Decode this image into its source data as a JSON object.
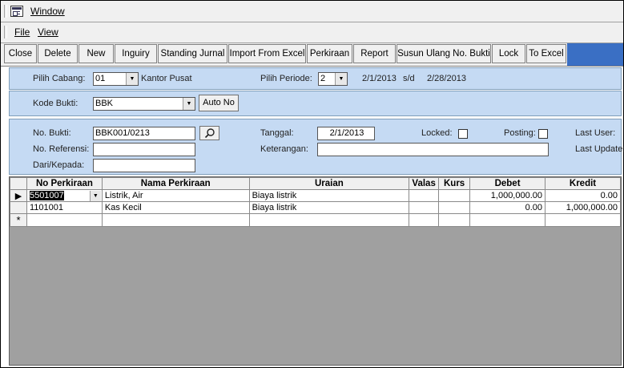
{
  "window_menu": {
    "label": "Window",
    "icon": "window-icon"
  },
  "menus": {
    "file": "File",
    "view": "View"
  },
  "toolbar": {
    "close": "Close",
    "delete": "Delete",
    "new": "New",
    "inquiry": "Inguiry",
    "standing_jurnal": "Standing Jurnal",
    "import_excel": "Import From Excel",
    "perkiraan": "Perkiraan",
    "report": "Report",
    "susun_ulang": "Susun Ulang No. Bukti",
    "lock": "Lock",
    "to_excel": "To Excel"
  },
  "filter": {
    "cabang_label": "Pilih Cabang:",
    "cabang_value": "01",
    "cabang_name": "Kantor Pusat",
    "periode_label": "Pilih Periode:",
    "periode_value": "2",
    "periode_from": "2/1/2013",
    "periode_sep": "s/d",
    "periode_to": "2/28/2013"
  },
  "kode": {
    "label": "Kode Bukti:",
    "value": "BBK",
    "auto_no": "Auto No"
  },
  "form": {
    "no_bukti_label": "No. Bukti:",
    "no_bukti_value": "BBK001/0213",
    "no_referensi_label": "No. Referensi:",
    "no_referensi_value": "",
    "dari_kepada_label": "Dari/Kepada:",
    "dari_kepada_value": "",
    "tanggal_label": "Tanggal:",
    "tanggal_value": "2/1/2013",
    "keterangan_label": "Keterangan:",
    "keterangan_value": "",
    "locked_label": "Locked:",
    "posting_label": "Posting:",
    "last_user_label": "Last User:",
    "last_update_label": "Last Update:"
  },
  "grid": {
    "columns": [
      "No Perkiraan",
      "Nama Perkiraan",
      "Uraian",
      "Valas",
      "Kurs",
      "Debet",
      "Kredit"
    ],
    "rows": [
      {
        "no": "5501007",
        "nama": "Listrik, Air",
        "uraian": "Biaya listrik",
        "valas": "",
        "kurs": "",
        "debet": "1,000,000.00",
        "kredit": "0.00"
      },
      {
        "no": "1101001",
        "nama": "Kas Kecil",
        "uraian": "Biaya listrik",
        "valas": "",
        "kurs": "",
        "debet": "0.00",
        "kredit": "1,000,000.00"
      }
    ],
    "new_row_marker": "*",
    "current_row_marker": "▶"
  }
}
